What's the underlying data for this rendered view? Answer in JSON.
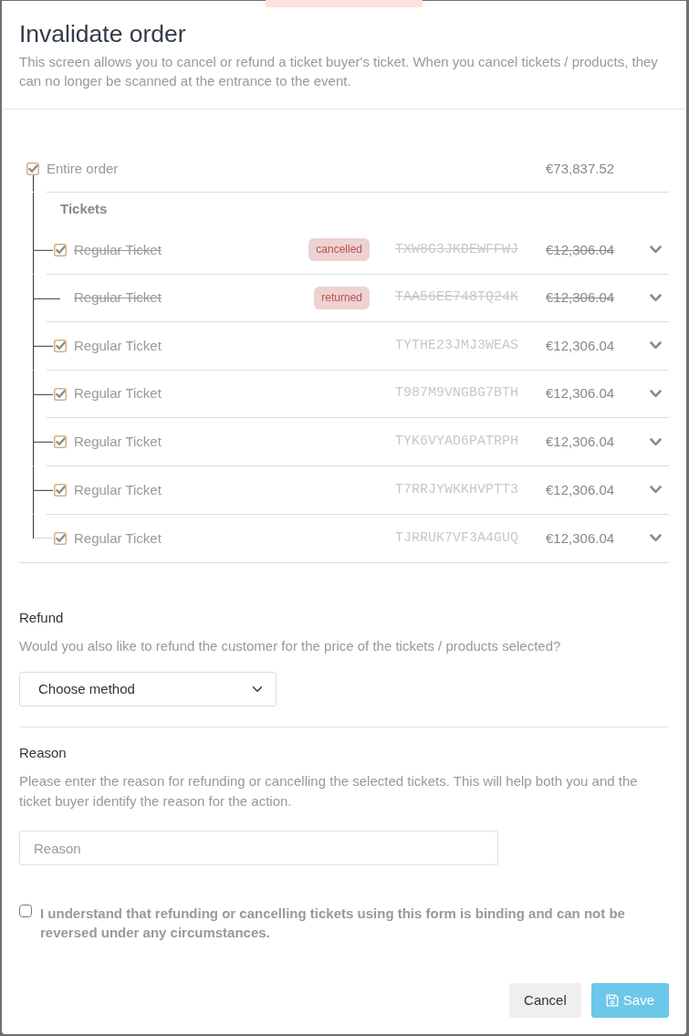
{
  "modal": {
    "title": "Invalidate order",
    "description": "This screen allows you to cancel or refund a ticket buyer's ticket. When you cancel tickets / products, they can no longer be scanned at the entrance to the event."
  },
  "order": {
    "label": "Entire order",
    "checked": true,
    "total": "€73,837.52"
  },
  "tickets_heading": "Tickets",
  "tickets": [
    {
      "kind": "checkable",
      "checked": true,
      "name": "Regular Ticket",
      "badge": "cancelled",
      "code": "TXW8G3JKDEWFFWJ",
      "price": "€12,306.04",
      "struck": true
    },
    {
      "kind": "locked",
      "name": "Regular Ticket",
      "badge": "returned",
      "code": "TAA56EE748TQ24K",
      "price": "€12,306.04",
      "struck": true
    },
    {
      "kind": "checkable",
      "checked": true,
      "name": "Regular Ticket",
      "code": "TYTHE23JMJ3WEAS",
      "price": "€12,306.04",
      "struck": false
    },
    {
      "kind": "checkable",
      "checked": true,
      "name": "Regular Ticket",
      "code": "T987M9VNGBG7BTH",
      "price": "€12,306.04",
      "struck": false
    },
    {
      "kind": "checkable",
      "checked": true,
      "name": "Regular Ticket",
      "code": "TYK6VYAD6PATRPH",
      "price": "€12,306.04",
      "struck": false
    },
    {
      "kind": "checkable",
      "checked": true,
      "name": "Regular Ticket",
      "code": "T7RRJYWKKHVPTT3",
      "price": "€12,306.04",
      "struck": false
    },
    {
      "kind": "checkable",
      "checked": true,
      "name": "Regular Ticket",
      "code": "TJRRUK7VF3A4GUQ",
      "price": "€12,306.04",
      "struck": false
    }
  ],
  "refund": {
    "label": "Refund",
    "help": "Would you also like to refund the customer for the price of the tickets / products selected?",
    "select": {
      "value": "Choose method"
    }
  },
  "reason": {
    "label": "Reason",
    "help": "Please enter the reason for refunding or cancelling the selected tickets. This will help both you and the ticket buyer identify the reason for the action.",
    "placeholder": "Reason"
  },
  "agreement": {
    "text": "I understand that refunding or cancelling tickets using this form is binding and can not be reversed under any circumstances.",
    "checked": false
  },
  "buttons": [
    {
      "kind": "cancel",
      "label": "Cancel",
      "disabled": false
    },
    {
      "kind": "save",
      "label": "Save",
      "disabled": true
    }
  ]
}
